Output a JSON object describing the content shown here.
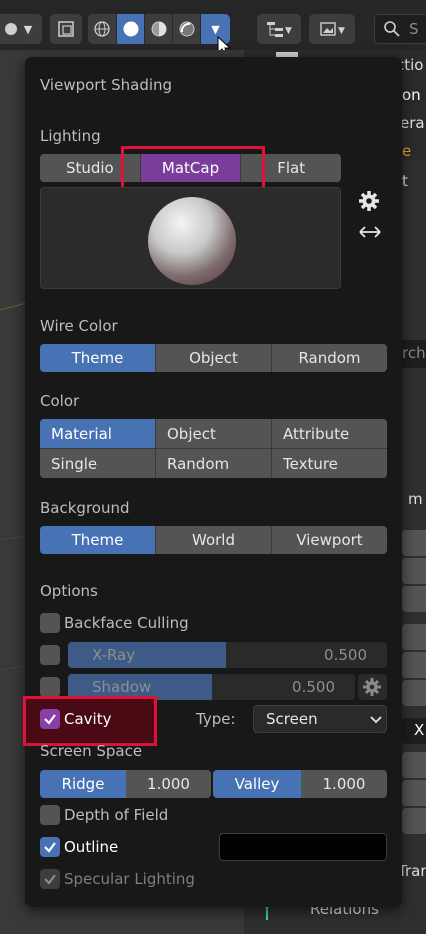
{
  "header": {
    "shading_modes": [
      "wireframe-icon",
      "solid-icon",
      "material-preview-icon",
      "rendered-icon"
    ],
    "search_placeholder": "S"
  },
  "background": {
    "right_panel_fragments": [
      "ctio",
      "on",
      "era",
      "e",
      "t",
      "rch",
      "m",
      "X",
      "Tran",
      "Relations"
    ]
  },
  "popover": {
    "title": "Viewport Shading",
    "lighting": {
      "heading": "Lighting",
      "options": [
        "Studio",
        "MatCap",
        "Flat"
      ],
      "selected": "MatCap"
    },
    "wire_color": {
      "heading": "Wire Color",
      "options": [
        "Theme",
        "Object",
        "Random"
      ],
      "selected": "Theme"
    },
    "color": {
      "heading": "Color",
      "options": [
        "Material",
        "Object",
        "Attribute",
        "Single",
        "Random",
        "Texture"
      ],
      "selected": "Material"
    },
    "background": {
      "heading": "Background",
      "options": [
        "Theme",
        "World",
        "Viewport"
      ],
      "selected": "Theme"
    },
    "options": {
      "heading": "Options",
      "backface_culling": {
        "label": "Backface Culling",
        "checked": false
      },
      "xray": {
        "label": "X-Ray",
        "value": "0.500",
        "checked": false
      },
      "shadow": {
        "label": "Shadow",
        "value": "0.500",
        "checked": false
      },
      "cavity": {
        "label": "Cavity",
        "checked": true
      },
      "type_label": "Type:",
      "type_value": "Screen",
      "screen_space": "Screen Space",
      "ridge": {
        "label": "Ridge",
        "value": "1.000"
      },
      "valley": {
        "label": "Valley",
        "value": "1.000"
      },
      "depth_of_field": {
        "label": "Depth of Field",
        "checked": false
      },
      "outline": {
        "label": "Outline",
        "checked": true,
        "color": "#000000"
      },
      "specular": {
        "label": "Specular Lighting",
        "checked": true
      }
    }
  },
  "colors": {
    "accent_blue": "#4772b3",
    "matcap_purple": "#7a3e9a",
    "cavity_purple": "#8a3fa8",
    "highlight_red": "#e0123a",
    "orange": "#e8a33a"
  }
}
